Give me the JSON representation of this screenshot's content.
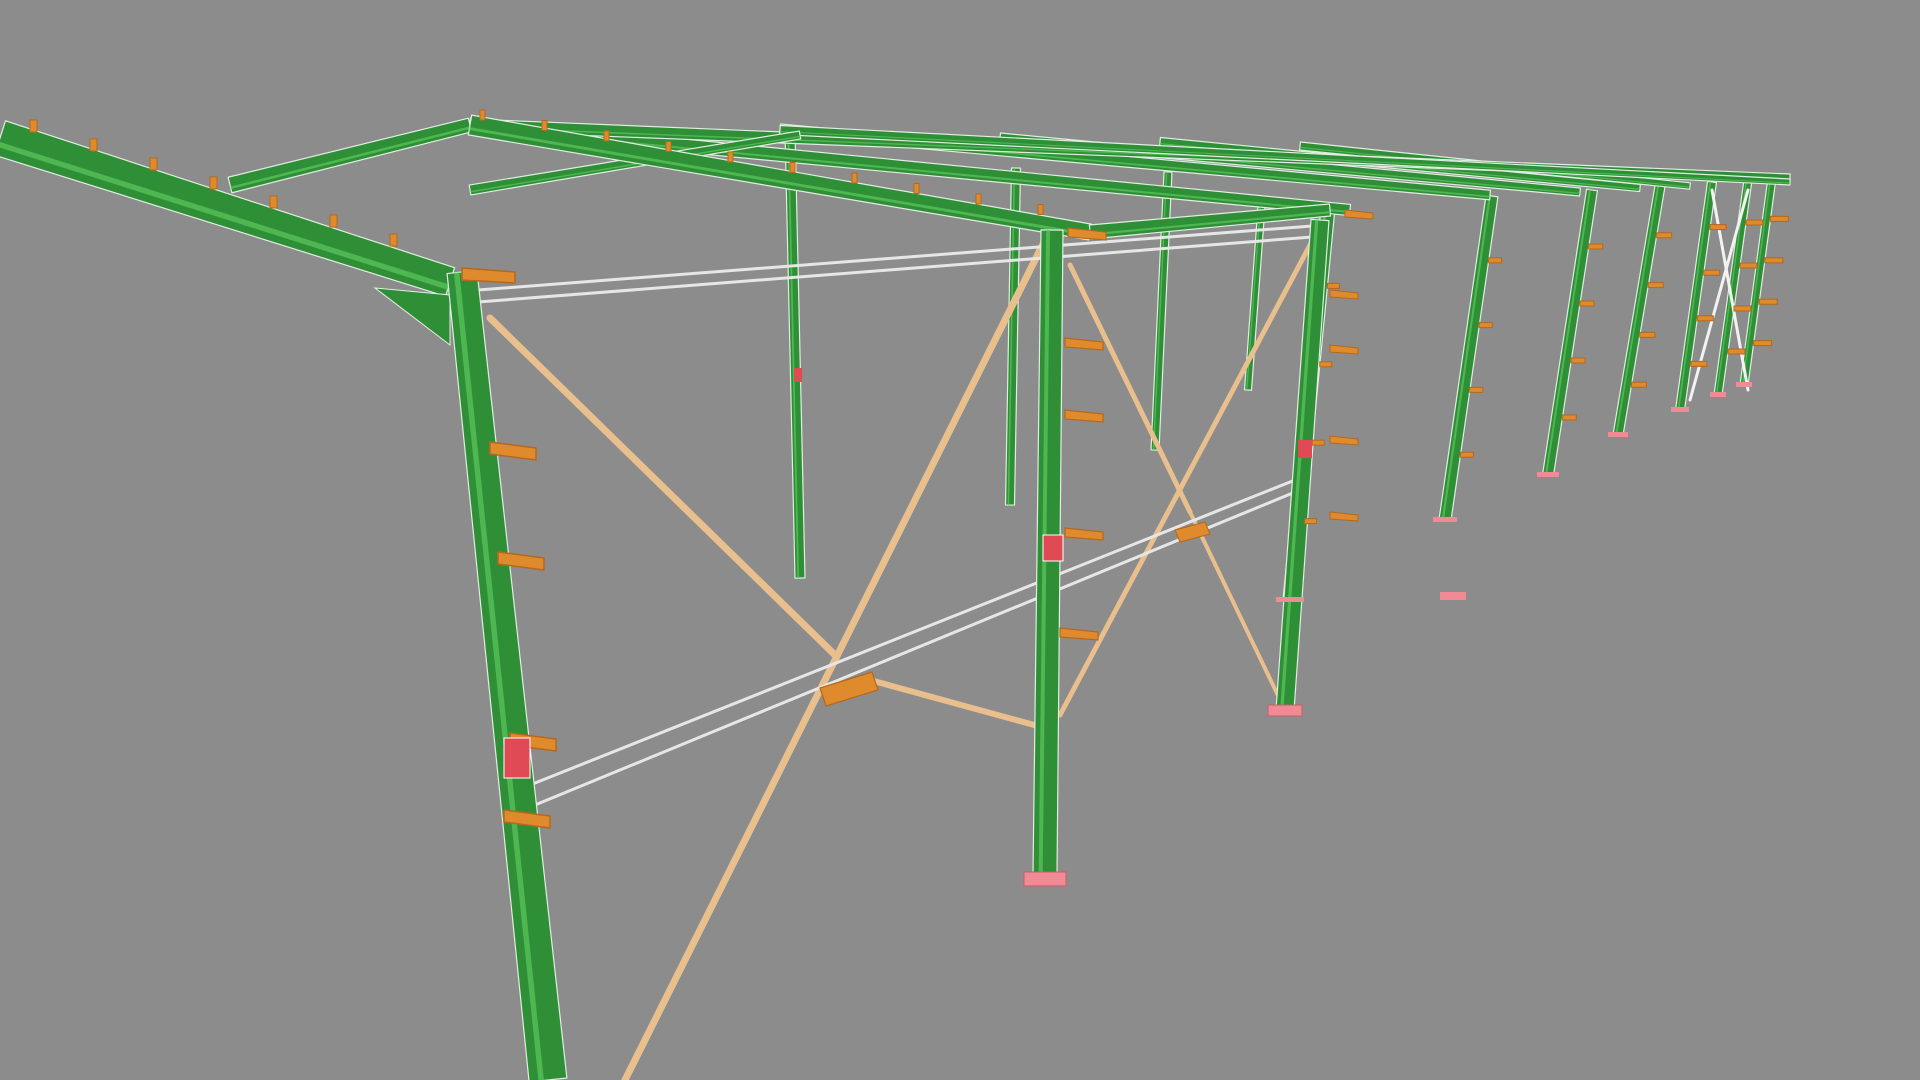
{
  "scene": {
    "subject": "steel-frame-building-3d-model",
    "background_color": "#8c8c8c",
    "colors": {
      "steel_beam": "#2f8f36",
      "steel_beam_highlight": "#5cc85f",
      "steel_beam_shadow": "#1f6b26",
      "edge_line": "#dfeee0",
      "purlin_girt": "#e08a2e",
      "purlin_girt_dark": "#b5681c",
      "cross_bracing": "#e9bf8e",
      "strut_tube": "#e6e6e6",
      "base_plate": "#f08a94",
      "connection_plate": "#e04a55"
    },
    "icons": {
      "model": "steel-structure-icon"
    }
  }
}
